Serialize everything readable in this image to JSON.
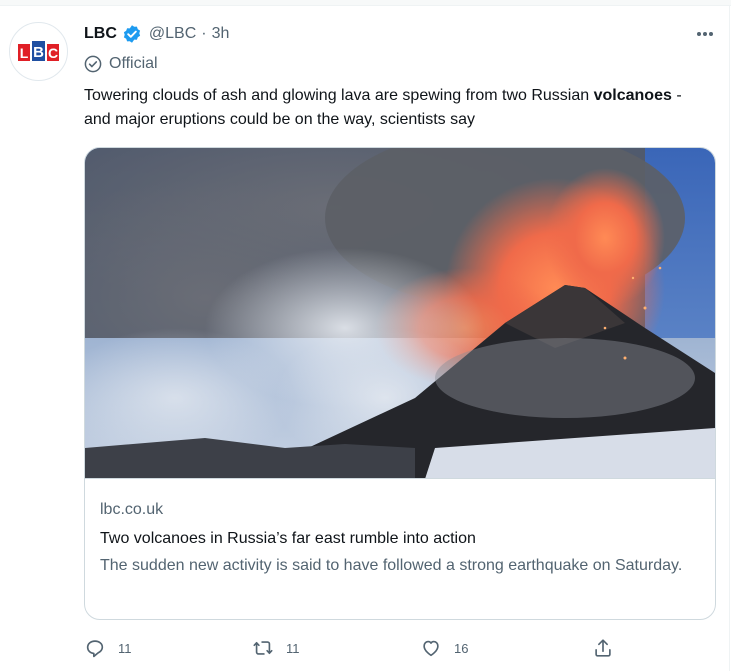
{
  "tweet": {
    "display_name": "LBC",
    "handle": "@LBC",
    "separator": "·",
    "timestamp": "3h",
    "affiliation": "Official",
    "text_part1": "Towering clouds of ash and glowing lava are spewing from two Russian ",
    "text_bold": "volcanoes",
    "text_part2": " - and major eruptions could be on the way, scientists say",
    "avatar_text": "LBC"
  },
  "card": {
    "domain": "lbc.co.uk",
    "title": "Two volcanoes in Russia’s far east rumble into action",
    "description": "The sudden new activity is said to have followed a strong earthquake on Saturday."
  },
  "actions": {
    "reply_count": "11",
    "retweet_count": "11",
    "like_count": "16"
  },
  "icons": {
    "verified": "verified-badge-icon",
    "affiliation": "check-circle-icon",
    "more": "more-dots-icon",
    "reply": "reply-icon",
    "retweet": "retweet-icon",
    "like": "heart-icon",
    "share": "share-icon"
  },
  "colors": {
    "verified_blue": "#1d9bf0",
    "text_primary": "#0f1419",
    "text_secondary": "#536471",
    "border": "#cfd9de",
    "brand_red": "#e01f26",
    "brand_blue": "#1f4fa1"
  }
}
